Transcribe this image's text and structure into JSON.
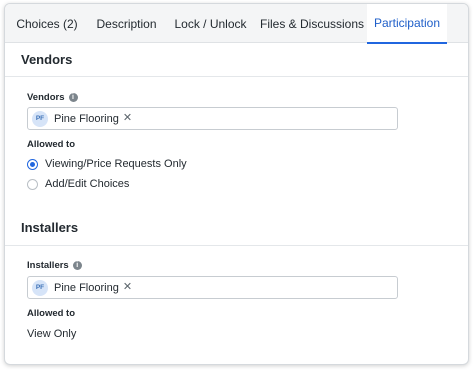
{
  "tabs": [
    {
      "label": "Choices (2)"
    },
    {
      "label": "Description"
    },
    {
      "label": "Lock / Unlock"
    },
    {
      "label": "Files & Discussions"
    },
    {
      "label": "Participation"
    }
  ],
  "active_tab": "Participation",
  "vendors": {
    "section_title": "Vendors",
    "field_label": "Vendors",
    "tokens": [
      {
        "initials": "PF",
        "label": "Pine Flooring"
      }
    ],
    "allowed_label": "Allowed to",
    "options": [
      {
        "label": "Viewing/Price Requests Only",
        "selected": true
      },
      {
        "label": "Add/Edit Choices",
        "selected": false
      }
    ]
  },
  "installers": {
    "section_title": "Installers",
    "field_label": "Installers",
    "tokens": [
      {
        "initials": "PF",
        "label": "Pine Flooring"
      }
    ],
    "allowed_label": "Allowed to",
    "allowed_value": "View Only"
  },
  "colors": {
    "accent": "#2066df",
    "tab_bar": "#f4f5f6"
  },
  "icons": {
    "info": "info-icon",
    "remove": "close-icon"
  }
}
